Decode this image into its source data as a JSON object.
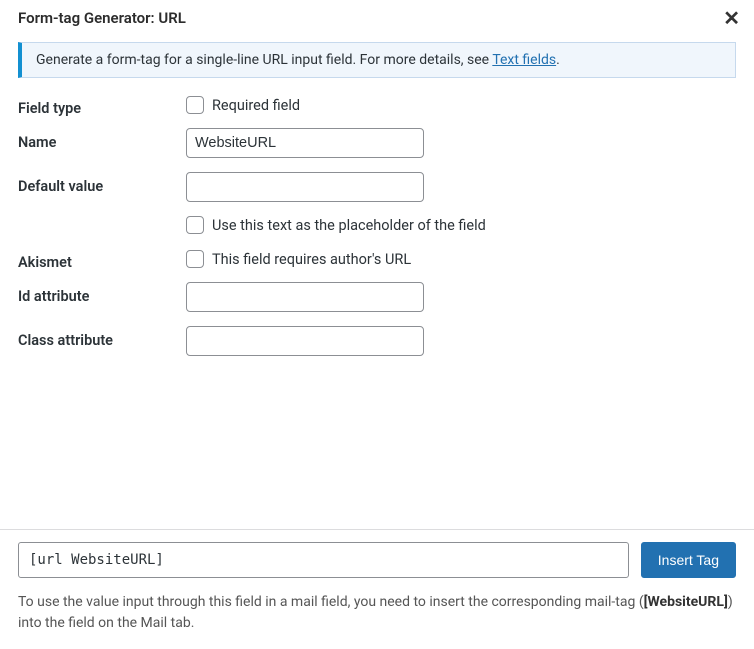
{
  "dialog": {
    "title": "Form-tag Generator: URL",
    "info_prefix": "Generate a form-tag for a single-line URL input field. For more details, see ",
    "info_link": "Text fields",
    "info_suffix": "."
  },
  "form": {
    "field_type_label": "Field type",
    "required_label": "Required field",
    "name_label": "Name",
    "name_value": "WebsiteURL",
    "default_value_label": "Default value",
    "default_value_value": "",
    "placeholder_checkbox_label": "Use this text as the placeholder of the field",
    "akismet_label": "Akismet",
    "akismet_checkbox_label": "This field requires author's URL",
    "id_attr_label": "Id attribute",
    "id_attr_value": "",
    "class_attr_label": "Class attribute",
    "class_attr_value": ""
  },
  "footer": {
    "code_output": "[url WebsiteURL]",
    "insert_button": "Insert Tag",
    "note_prefix": "To use the value input through this field in a mail field, you need to insert the corresponding mail-tag (",
    "note_tag": "[WebsiteURL]",
    "note_suffix": ") into the field on the Mail tab."
  }
}
